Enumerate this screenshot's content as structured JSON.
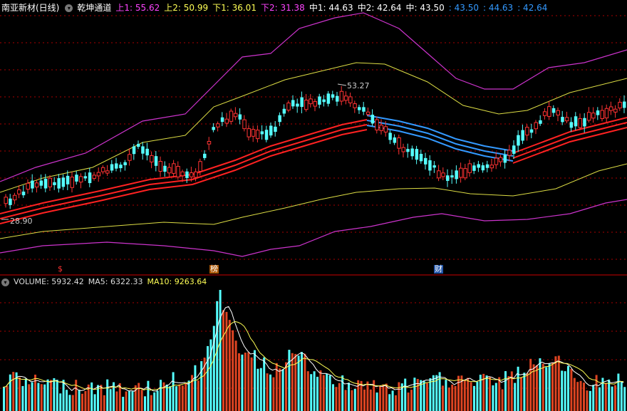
{
  "header": {
    "stock_name": "南亚新材(日线)",
    "indicator_name": "乾坤通道",
    "values": [
      {
        "label": "上1: 55.62",
        "color": "#ff44ff"
      },
      {
        "label": "上2: 50.99",
        "color": "#ffff55"
      },
      {
        "label": "下1: 36.01",
        "color": "#ffff55"
      },
      {
        "label": "下2: 31.38",
        "color": "#ff44ff"
      },
      {
        "label": "中1: 44.63",
        "color": "#ffffff"
      },
      {
        "label": "中2: 42.64",
        "color": "#ffffff"
      },
      {
        "label": "中: 43.50",
        "color": "#ffffff"
      },
      {
        "label": ": 43.50",
        "color": "#3399ff"
      },
      {
        "label": ": 44.63",
        "color": "#3399ff"
      },
      {
        "label": ": 42.64",
        "color": "#3399ff"
      }
    ]
  },
  "price_labels": {
    "high": "53.27",
    "low": "28.90"
  },
  "markers": [
    {
      "text": "$",
      "color": "#ff3333",
      "bg": "#000000"
    },
    {
      "text": "榜",
      "color": "#ffffff",
      "bg": "#aa5500"
    },
    {
      "text": "财",
      "color": "#ffffff",
      "bg": "#2255aa"
    }
  ],
  "volume": {
    "title": "VOLUME: 5932.42",
    "ma5": "MA5: 6322.33",
    "ma10": "MA10: 9263.64",
    "colors": {
      "title": "#dddddd",
      "ma5": "#dddddd",
      "ma10": "#ffff55"
    }
  },
  "colors": {
    "up": "#ff3333",
    "down": "#55ffff",
    "band_outer": "#cc33cc",
    "band_inner": "#dddd44",
    "channel_red": "#ff2222",
    "channel_blue": "#3399ff",
    "grid": "#aa0000"
  }
}
